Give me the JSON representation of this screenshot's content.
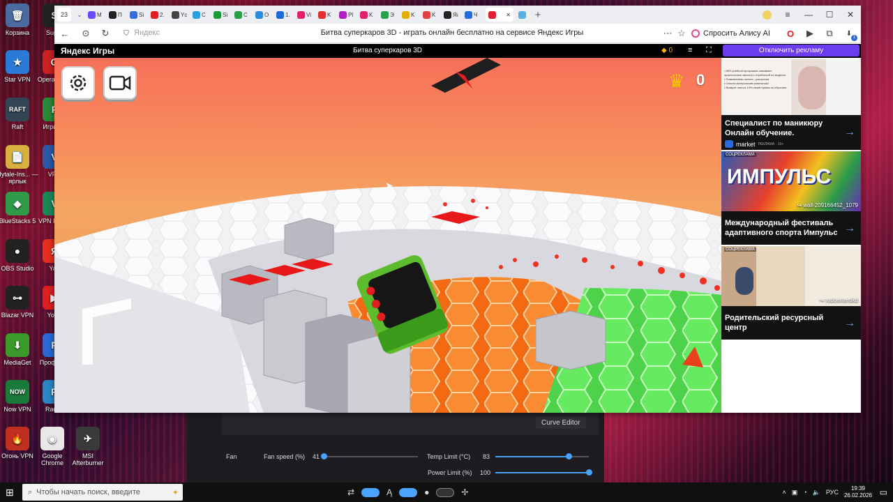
{
  "desktop": {
    "icons": [
      {
        "label": "Корзина",
        "glyph": "🗑",
        "color": "#4a6aa0"
      },
      {
        "label": "Star VPN",
        "glyph": "★",
        "color": "#2a7bd8"
      },
      {
        "label": "Raft",
        "glyph": "RAFT",
        "color": "#345"
      },
      {
        "label": "Hytale-Ins... — ярлык",
        "glyph": "📄",
        "color": "#d8b040"
      },
      {
        "label": "BlueStacks 5",
        "glyph": "◆",
        "color": "#2e9a4a"
      },
      {
        "label": "OBS Studio",
        "glyph": "●",
        "color": "#222"
      },
      {
        "label": "Blazar VPN",
        "glyph": "⊶",
        "color": "#222"
      },
      {
        "label": "MediaGet",
        "glyph": "⬇",
        "color": "#3a9a2a"
      },
      {
        "label": "Now VPN",
        "glyph": "NOW",
        "color": "#1a7a3a"
      },
      {
        "label": "Огонь VPN",
        "glyph": "🔥",
        "color": "#c03020"
      }
    ],
    "icons_col2": [
      {
        "label": "Super",
        "glyph": "S",
        "color": "#222"
      },
      {
        "label": "Opera Comi",
        "glyph": "O",
        "color": "#c22"
      },
      {
        "label": "Игры се",
        "glyph": "F",
        "color": "#2a8a3a"
      },
      {
        "label": "VPN",
        "glyph": "V",
        "color": "#2a5aa8"
      },
      {
        "label": "VPN F Mas",
        "glyph": "V",
        "color": "#1a8a5a"
      },
      {
        "label": "Yan",
        "glyph": "Я",
        "color": "#e83020"
      },
      {
        "label": "YouT",
        "glyph": "▶",
        "color": "#e02020"
      },
      {
        "label": "Профи Ed",
        "glyph": "P",
        "color": "#2a6ad8"
      },
      {
        "label": "Radmi",
        "glyph": "R",
        "color": "#2a88c8"
      }
    ],
    "shortcuts": [
      {
        "label": "Google Chrome",
        "glyph": "◉",
        "color": "#e8e8e8"
      },
      {
        "label": "MSI Afterburner",
        "glyph": "✈",
        "color": "#3a3a3a"
      }
    ]
  },
  "browser": {
    "tab_counter": "23",
    "tab_labels": [
      "M",
      "П",
      "Si",
      "2.",
      "Yc",
      "C",
      "Si",
      "C",
      "O",
      "1.",
      "Vi",
      "K",
      "Pl",
      "K",
      "Э",
      "K",
      "K",
      "Яı",
      "Ч"
    ],
    "tab_colors": [
      "#6a4cff",
      "#222",
      "#3a6ad8",
      "#e02020",
      "#444",
      "#2aa0e0",
      "#1a9a3a",
      "#2aa04a",
      "#2a8ad8",
      "#1a6ad8",
      "#e0206a",
      "#e03030",
      "#b020c0",
      "#e0206a",
      "#2aa04a",
      "#e0b000",
      "#e04040",
      "#222",
      "#2a6ad8"
    ],
    "active_tab_label": "Ч",
    "address_placeholder": "Яндекс",
    "page_title": "Битва суперкаров 3D - играть онлайн бесплатно на сервисе Яндекс Игры",
    "alice_label": "Спросить Алису AI",
    "notification_count": "1"
  },
  "yandex_games": {
    "logo": "Яндекс Игры",
    "game_title": "Битва суперкаров 3D",
    "coins": "0",
    "disable_ads_label": "Отключить рекламу"
  },
  "game": {
    "score": "0"
  },
  "ads": [
    {
      "title": "Специалист по маникюру Онлайн обучение.",
      "source": "market",
      "tag": "РЕКЛАМА · 16+",
      "body_lines": [
        "• 88% учебной программы занимают практические занятия с отработкой на моделях",
        "• Пожизненная оплата - рассрочка",
        "• Оплата материнским капиталом!",
        "• Возврат налога 13% своей суммы за обучение"
      ]
    },
    {
      "label": "СОЦРЕКЛАМА",
      "headline": "ИМПУЛЬС",
      "link": "wall-209166452_1079",
      "title": "Международный фестиваль адаптивного спорта Импульс"
    },
    {
      "label": "СОЦРЕКЛАМА",
      "link": "rodcenterdkd",
      "title": "Родительский ресурсный центр"
    }
  ],
  "msi": {
    "curve_editor": "Curve Editor",
    "fan_label": "Fan",
    "fan_speed_label": "Fan speed (%)",
    "fan_speed_value": "41",
    "fan_speed_fraction": 0.0,
    "temp_limit_label": "Temp Limit (°C)",
    "temp_limit_value": "83",
    "temp_limit_fraction": 0.78,
    "power_limit_label": "Power Limit (%)",
    "power_limit_value": "100",
    "power_limit_fraction": 1.0
  },
  "taskbar": {
    "search_placeholder": "Чтобы начать поиск, введите",
    "language": "РУС",
    "time": "19:39",
    "date": "26.02.2026"
  },
  "colors": {
    "sky_top": "#f7705a",
    "orange_hex": "#f26a10",
    "green_hex": "#5fe35a",
    "accent_purple": "#6c3cf0"
  }
}
